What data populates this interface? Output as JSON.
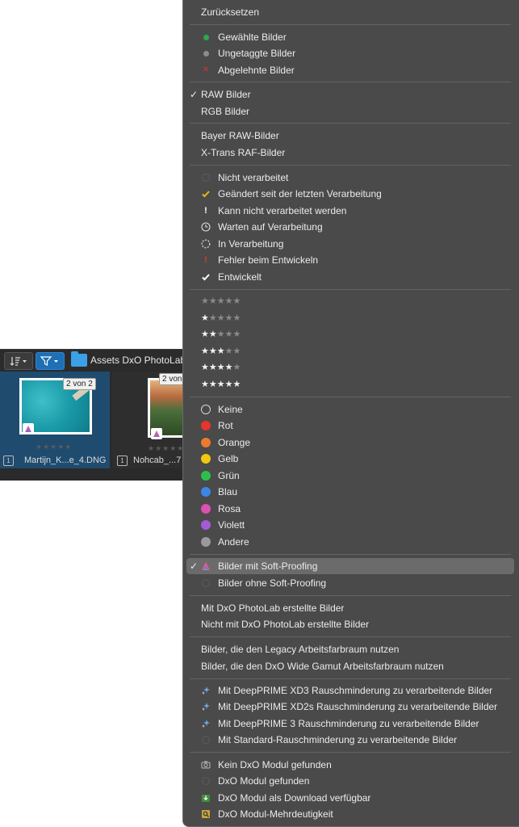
{
  "browser": {
    "folder_name": "Assets DxO PhotoLab",
    "thumbnails": [
      {
        "badge": "2 von 2",
        "count": "1",
        "filename": "Martijn_K...e_4.DNG",
        "stars": "★★★★★"
      },
      {
        "badge": "2 von",
        "count": "1",
        "filename": "Nohcab_...7",
        "stars": "★★★★★"
      }
    ]
  },
  "menu": {
    "reset": "Zurücksetzen",
    "tags": [
      {
        "label": "Gewählte Bilder",
        "icon": "green-dot-icon",
        "color": "#2ea84a"
      },
      {
        "label": "Ungetaggte Bilder",
        "icon": "gray-dot-icon",
        "color": "#8c8c8c"
      },
      {
        "label": "Abgelehnte Bilder",
        "icon": "red-x-icon",
        "color": "#d9332b"
      }
    ],
    "raw_images": "RAW Bilder",
    "rgb_images": "RGB Bilder",
    "bayer_raw": "Bayer RAW-Bilder",
    "xtrans_raf": "X-Trans RAF-Bilder",
    "processing": [
      {
        "label": "Nicht verarbeitet",
        "icon": "empty-circle-icon"
      },
      {
        "label": "Geändert seit der letzten Verarbeitung",
        "icon": "orange-check-icon"
      },
      {
        "label": "Kann nicht verarbeitet werden",
        "icon": "exclamation-icon"
      },
      {
        "label": "Warten auf Verarbeitung",
        "icon": "clock-icon"
      },
      {
        "label": "In Verarbeitung",
        "icon": "spinner-icon"
      },
      {
        "label": "Fehler beim Entwickeln",
        "icon": "red-exclamation-icon"
      },
      {
        "label": "Entwickelt",
        "icon": "check-icon"
      }
    ],
    "ratings": [
      0,
      1,
      2,
      3,
      4,
      5
    ],
    "colors": [
      {
        "label": "Keine",
        "color": "none"
      },
      {
        "label": "Rot",
        "color": "#e5352c"
      },
      {
        "label": "Orange",
        "color": "#ec7a2f"
      },
      {
        "label": "Gelb",
        "color": "#f2c712"
      },
      {
        "label": "Grün",
        "color": "#2cc04a"
      },
      {
        "label": "Blau",
        "color": "#3b86e8"
      },
      {
        "label": "Rosa",
        "color": "#e04fb2"
      },
      {
        "label": "Violett",
        "color": "#a45ad8"
      },
      {
        "label": "Andere",
        "color": "#9a9a9a"
      }
    ],
    "softproof_with": "Bilder mit Soft-Proofing",
    "softproof_without": "Bilder ohne Soft-Proofing",
    "made_with_dxo": "Mit DxO PhotoLab erstellte Bilder",
    "not_made_with_dxo": "Nicht mit DxO PhotoLab erstellte Bilder",
    "legacy_space": "Bilder, die den Legacy Arbeitsfarbraum nutzen",
    "wide_gamut_space": "Bilder, die den DxO Wide Gamut Arbeitsfarbraum nutzen",
    "denoise": [
      {
        "label": "Mit DeepPRIME XD3 Rauschminderung zu verarbeitende Bilder",
        "icon": "sparkle-icon"
      },
      {
        "label": "Mit DeepPRIME XD2s Rauschminderung zu verarbeitende Bilder",
        "icon": "sparkle-icon"
      },
      {
        "label": "Mit DeepPRIME 3 Rauschminderung zu verarbeitende Bilder",
        "icon": "sparkle-icon"
      },
      {
        "label": "Mit Standard-Rauschminderung zu verarbeitende Bilder",
        "icon": "empty-circle-icon"
      }
    ],
    "modules": [
      {
        "label": "Kein DxO Modul gefunden",
        "icon": "camera-icon"
      },
      {
        "label": "DxO Modul gefunden",
        "icon": "empty-circle-icon"
      },
      {
        "label": "DxO Modul als Download verfügbar",
        "icon": "download-icon"
      },
      {
        "label": "DxO Modul-Mehrdeutigkeit",
        "icon": "module-search-icon"
      }
    ],
    "checkmark": "✓"
  },
  "colors": {
    "menu_bg": "#4a4a4a",
    "highlight_bg": "#6b6b6b",
    "accent": "#1f6fb5"
  }
}
